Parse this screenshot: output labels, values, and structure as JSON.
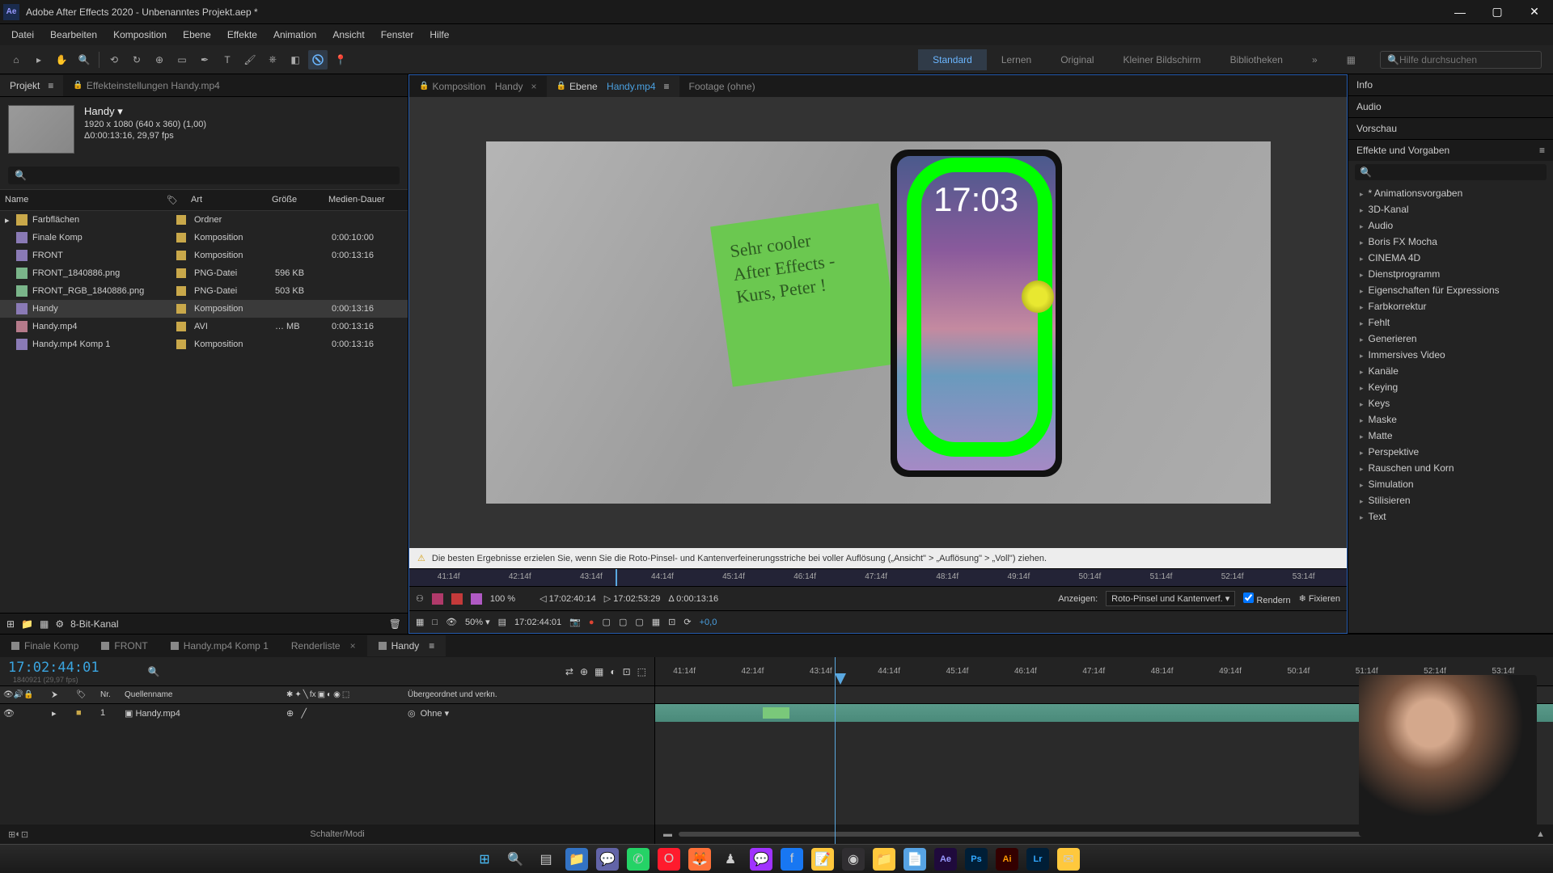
{
  "titlebar": {
    "app": "Adobe After Effects 2020 - Unbenanntes Projekt.aep *"
  },
  "menu": [
    "Datei",
    "Bearbeiten",
    "Komposition",
    "Ebene",
    "Effekte",
    "Animation",
    "Ansicht",
    "Fenster",
    "Hilfe"
  ],
  "workspaces": [
    "Standard",
    "Lernen",
    "Original",
    "Kleiner Bildschirm",
    "Bibliotheken"
  ],
  "active_workspace": "Standard",
  "help_search_placeholder": "Hilfe durchsuchen",
  "left_tabs": {
    "project": "Projekt",
    "effect_controls": "Effekteinstellungen  Handy.mp4"
  },
  "project_header": {
    "name": "Handy ▾",
    "dims": "1920 x 1080 (640 x 360) (1,00)",
    "dur": "Δ0:00:13:16, 29,97 fps"
  },
  "project_cols": {
    "name": "Name",
    "label": "",
    "type": "Art",
    "size": "Größe",
    "dur": "Medien-Dauer"
  },
  "project_items": [
    {
      "icon": "folder",
      "name": "Farbflächen",
      "type": "Ordner",
      "size": "",
      "dur": ""
    },
    {
      "icon": "comp",
      "name": "Finale Komp",
      "type": "Komposition",
      "size": "",
      "dur": "0:00:10:00"
    },
    {
      "icon": "comp",
      "name": "FRONT",
      "type": "Komposition",
      "size": "",
      "dur": "0:00:13:16"
    },
    {
      "icon": "img",
      "name": "FRONT_1840886.png",
      "type": "PNG-Datei",
      "size": "596 KB",
      "dur": ""
    },
    {
      "icon": "img",
      "name": "FRONT_RGB_1840886.png",
      "type": "PNG-Datei",
      "size": "503 KB",
      "dur": ""
    },
    {
      "icon": "comp",
      "name": "Handy",
      "type": "Komposition",
      "size": "",
      "dur": "0:00:13:16",
      "sel": true
    },
    {
      "icon": "vid",
      "name": "Handy.mp4",
      "type": "AVI",
      "size": "… MB",
      "dur": "0:00:13:16"
    },
    {
      "icon": "comp",
      "name": "Handy.mp4 Komp 1",
      "type": "Komposition",
      "size": "",
      "dur": "0:00:13:16"
    }
  ],
  "project_footer_bpc": "8-Bit-Kanal",
  "center_tabs": {
    "comp_prefix": "Komposition",
    "comp_name": "Handy",
    "layer_prefix": "Ebene",
    "layer_name": "Handy.mp4",
    "footage": "Footage  (ohne)"
  },
  "postit_text": "Sehr cooler\nAfter Effects -\nKurs, Peter !",
  "phone_time": "17:03",
  "info_bar": "Die besten Ergebnisse erzielen Sie, wenn Sie die Roto-Pinsel- und Kantenverfeinerungsstriche bei voller Auflösung („Ansicht\" > „Auflösung\" > „Voll\") ziehen.",
  "mini_ticks": [
    "41:14f",
    "42:14f",
    "43:14f",
    "44:14f",
    "45:14f",
    "46:14f",
    "47:14f",
    "48:14f",
    "49:14f",
    "50:14f",
    "51:14f",
    "52:14f",
    "53:14f"
  ],
  "viewer_ctl": {
    "time_in": "17:02:40:14",
    "time_out": "17:02:53:29",
    "dur": "Δ 0:00:13:16",
    "mode_label": "Anzeigen:",
    "mode": "Roto-Pinsel und Kantenverf.",
    "render": "Rendern",
    "freeze": "Fixieren",
    "pct": "100 %"
  },
  "viewer_footer": {
    "zoom": "50%",
    "tc": "17:02:44:01",
    "exposure": "+0,0"
  },
  "right": {
    "info": "Info",
    "audio": "Audio",
    "preview": "Vorschau",
    "effects_head": "Effekte und Vorgaben",
    "effects": [
      "* Animationsvorgaben",
      "3D-Kanal",
      "Audio",
      "Boris FX Mocha",
      "CINEMA 4D",
      "Dienstprogramm",
      "Eigenschaften für Expressions",
      "Farbkorrektur",
      "Fehlt",
      "Generieren",
      "Immersives Video",
      "Kanäle",
      "Keying",
      "Keys",
      "Maske",
      "Matte",
      "Perspektive",
      "Rauschen und Korn",
      "Simulation",
      "Stilisieren",
      "Text"
    ]
  },
  "timeline": {
    "tabs": [
      "Finale Komp",
      "FRONT",
      "Handy.mp4 Komp 1",
      "Renderliste",
      "Handy"
    ],
    "active_tab": "Handy",
    "timecode": "17:02:44:01",
    "sub": "1840921 (29,97 fps)",
    "cols": {
      "src": "Quellenname",
      "parent": "Übergeordnet und verkn.",
      "nr": "Nr."
    },
    "layer": {
      "n": "1",
      "name": "Handy.mp4",
      "parent": "Ohne"
    },
    "ruler": [
      "41:14f",
      "42:14f",
      "43:14f",
      "44:14f",
      "45:14f",
      "46:14f",
      "47:14f",
      "48:14f",
      "49:14f",
      "50:14f",
      "51:14f",
      "52:14f",
      "53:14f"
    ],
    "footer": "Schalter/Modi"
  },
  "taskbar_icons": [
    "windows",
    "search",
    "tasks",
    "explorer",
    "teams",
    "whatsapp",
    "opera",
    "firefox",
    "chess",
    "messenger",
    "facebook",
    "notes",
    "obs",
    "folder",
    "notepad",
    "ae",
    "ps",
    "ai",
    "lr",
    "pin"
  ]
}
